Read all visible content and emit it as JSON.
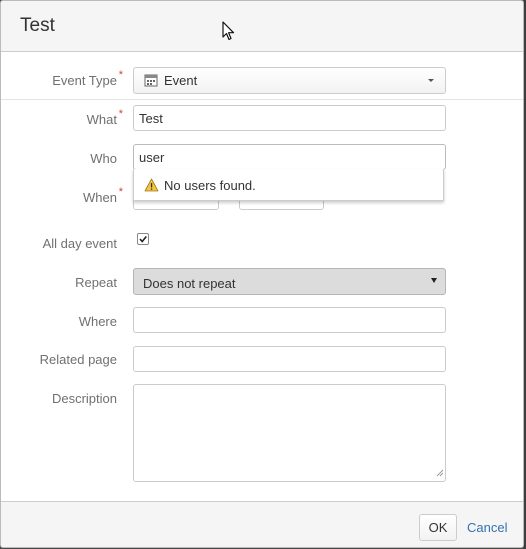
{
  "dialog": {
    "title": "Test"
  },
  "form": {
    "event_type": {
      "label": "Event Type",
      "value": "Event",
      "icon": "calendar-icon"
    },
    "what": {
      "label": "What",
      "value": "Test"
    },
    "who": {
      "label": "Who",
      "value": "user",
      "dropdown_message": "No users found.",
      "dropdown_icon": "warning-icon"
    },
    "when": {
      "label": "When"
    },
    "all_day": {
      "label": "All day event",
      "checked": true
    },
    "repeat": {
      "label": "Repeat",
      "value": "Does not repeat"
    },
    "where": {
      "label": "Where",
      "value": ""
    },
    "related_page": {
      "label": "Related page",
      "value": ""
    },
    "description": {
      "label": "Description",
      "value": ""
    }
  },
  "footer": {
    "ok_label": "OK",
    "cancel_label": "Cancel"
  },
  "colors": {
    "required": "#d04437",
    "link": "#3572b0",
    "warning": "#f6c342"
  }
}
